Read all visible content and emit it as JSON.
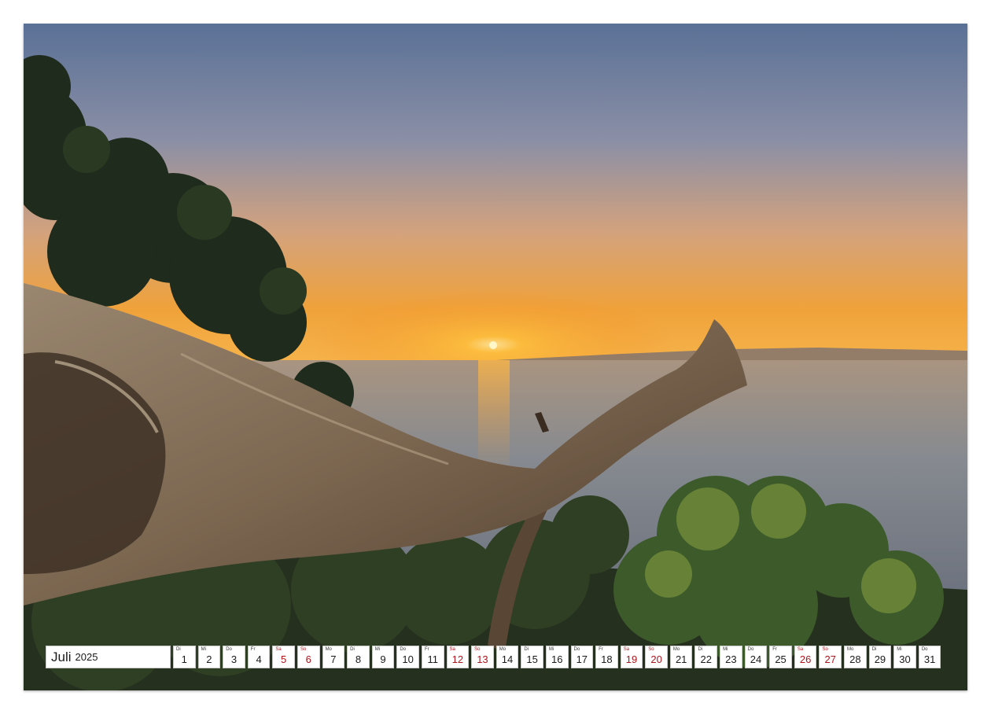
{
  "calendar": {
    "month": "Juli",
    "year": "2025",
    "days": [
      {
        "wd": "Di",
        "num": "1",
        "weekend": false
      },
      {
        "wd": "Mi",
        "num": "2",
        "weekend": false
      },
      {
        "wd": "Do",
        "num": "3",
        "weekend": false
      },
      {
        "wd": "Fr",
        "num": "4",
        "weekend": false
      },
      {
        "wd": "Sa",
        "num": "5",
        "weekend": true
      },
      {
        "wd": "So",
        "num": "6",
        "weekend": true
      },
      {
        "wd": "Mo",
        "num": "7",
        "weekend": false
      },
      {
        "wd": "Di",
        "num": "8",
        "weekend": false
      },
      {
        "wd": "Mi",
        "num": "9",
        "weekend": false
      },
      {
        "wd": "Do",
        "num": "10",
        "weekend": false
      },
      {
        "wd": "Fr",
        "num": "11",
        "weekend": false
      },
      {
        "wd": "Sa",
        "num": "12",
        "weekend": true
      },
      {
        "wd": "So",
        "num": "13",
        "weekend": true
      },
      {
        "wd": "Mo",
        "num": "14",
        "weekend": false
      },
      {
        "wd": "Di",
        "num": "15",
        "weekend": false
      },
      {
        "wd": "Mi",
        "num": "16",
        "weekend": false
      },
      {
        "wd": "Do",
        "num": "17",
        "weekend": false
      },
      {
        "wd": "Fr",
        "num": "18",
        "weekend": false
      },
      {
        "wd": "Sa",
        "num": "19",
        "weekend": true
      },
      {
        "wd": "So",
        "num": "20",
        "weekend": true
      },
      {
        "wd": "Mo",
        "num": "21",
        "weekend": false
      },
      {
        "wd": "Di",
        "num": "22",
        "weekend": false
      },
      {
        "wd": "Mi",
        "num": "23",
        "weekend": false
      },
      {
        "wd": "Do",
        "num": "24",
        "weekend": false
      },
      {
        "wd": "Fr",
        "num": "25",
        "weekend": false
      },
      {
        "wd": "Sa",
        "num": "26",
        "weekend": true
      },
      {
        "wd": "So",
        "num": "27",
        "weekend": true
      },
      {
        "wd": "Mo",
        "num": "28",
        "weekend": false
      },
      {
        "wd": "Di",
        "num": "29",
        "weekend": false
      },
      {
        "wd": "Mi",
        "num": "30",
        "weekend": false
      },
      {
        "wd": "Do",
        "num": "31",
        "weekend": false
      }
    ]
  },
  "colors": {
    "weekend": "#b0141c",
    "sky_top": "#5d7497",
    "sunset_glow": "#f09a2a",
    "sea": "#7d8590"
  }
}
